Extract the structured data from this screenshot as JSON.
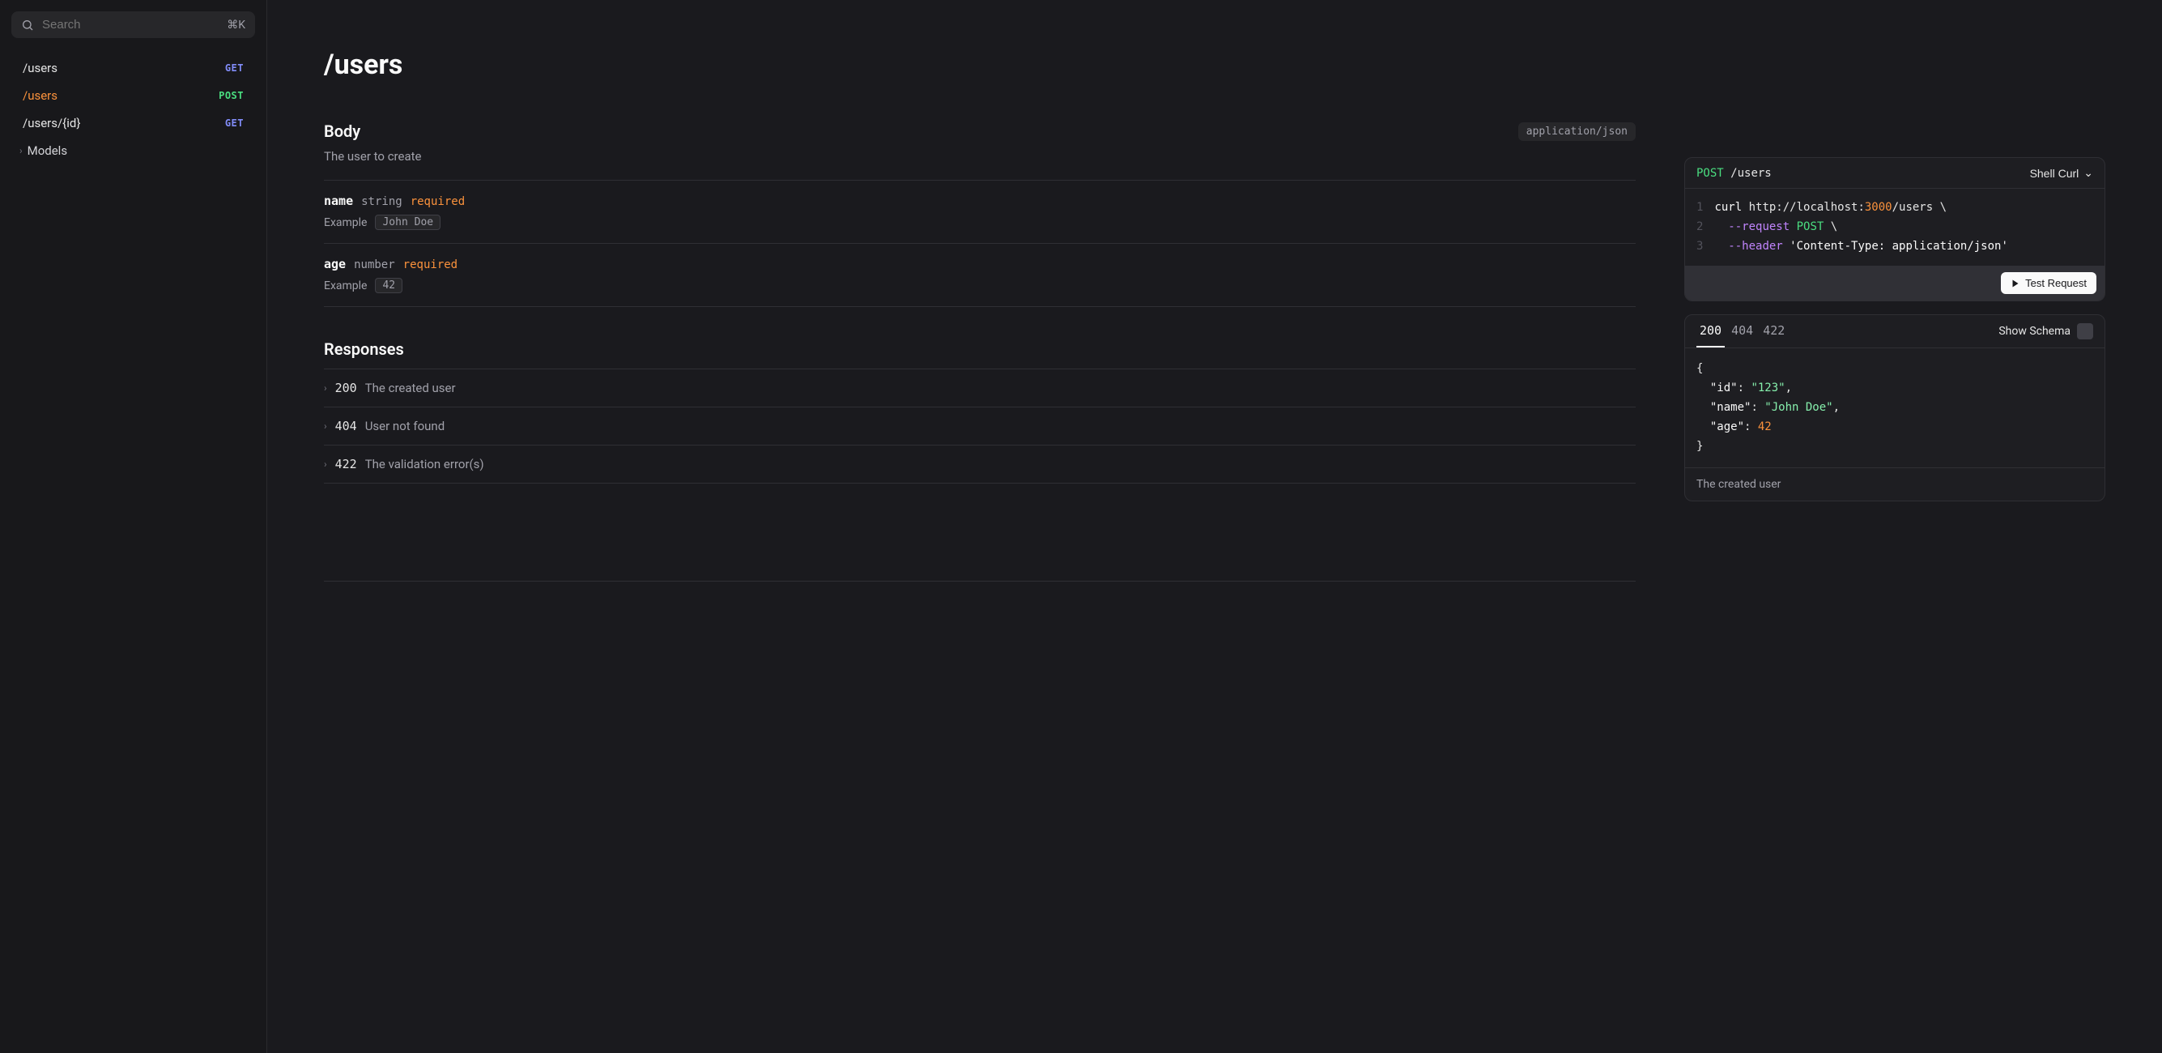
{
  "search": {
    "placeholder": "Search",
    "kbd": "⌘K"
  },
  "nav": {
    "items": [
      {
        "path": "/users",
        "method": "GET"
      },
      {
        "path": "/users",
        "method": "POST"
      },
      {
        "path": "/users/{id}",
        "method": "GET"
      }
    ],
    "models_label": "Models"
  },
  "page": {
    "title": "/users",
    "body_heading": "Body",
    "content_type": "application/json",
    "body_desc": "The user to create",
    "example_label": "Example",
    "required_label": "required",
    "params": [
      {
        "name": "name",
        "type": "string",
        "example": "John Doe"
      },
      {
        "name": "age",
        "type": "number",
        "example": "42"
      }
    ],
    "responses_heading": "Responses",
    "responses": [
      {
        "code": "200",
        "desc": "The created user"
      },
      {
        "code": "404",
        "desc": "User not found"
      },
      {
        "code": "422",
        "desc": "The validation error(s)"
      }
    ]
  },
  "request_panel": {
    "method": "POST",
    "path": "/users",
    "lang": "Shell Curl",
    "code_html": "<span class=\"ln\">1</span><span class=\"tok-cmd\">curl</span> http://localhost:<span class=\"tok-num\">3000</span>/users \\\n<span class=\"ln\">2</span>  <span class=\"tok-flag\">--request</span> <span class=\"tok-meth\">POST</span> \\\n<span class=\"ln\">3</span>  <span class=\"tok-flag\">--header</span> <span class=\"tok-str\">'Content-Type: application/json'</span>",
    "test_label": "Test Request"
  },
  "response_panel": {
    "tabs": [
      "200",
      "404",
      "422"
    ],
    "schema_label": "Show Schema",
    "body_html": "{\n  <span class=\"tok-key\">\"id\"</span>: <span class=\"tok-sval\">\"123\"</span>,\n  <span class=\"tok-key\">\"name\"</span>: <span class=\"tok-sval\">\"John Doe\"</span>,\n  <span class=\"tok-key\">\"age\"</span>: <span class=\"tok-num\">42</span>\n}",
    "footer": "The created user"
  }
}
